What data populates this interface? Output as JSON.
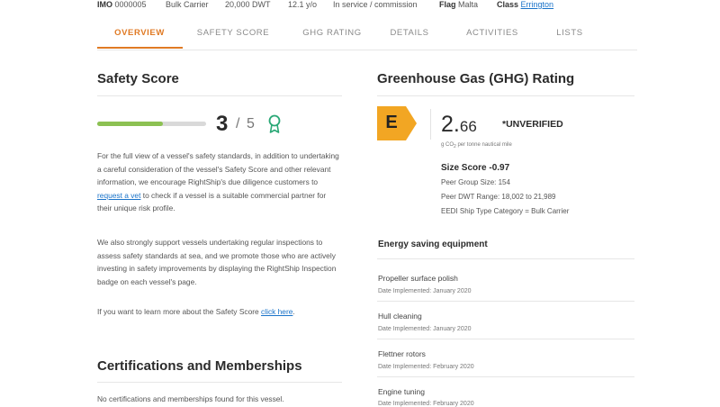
{
  "vessel_info": {
    "imo_label": "IMO",
    "imo_value": "0000005",
    "type": "Bulk Carrier",
    "dwt": "20,000 DWT",
    "age": "12.1 y/o",
    "status": "In service / commission",
    "flag_label": "Flag",
    "flag_value": "Malta",
    "class_label": "Class",
    "class_value": "Errington"
  },
  "tabs": [
    {
      "label": "OVERVIEW",
      "active": true
    },
    {
      "label": "SAFETY SCORE",
      "active": false
    },
    {
      "label": "GHG RATING",
      "active": false
    },
    {
      "label": "DETAILS",
      "active": false
    },
    {
      "label": "ACTIVITIES",
      "active": false
    },
    {
      "label": "LISTS",
      "active": false
    }
  ],
  "safety": {
    "title": "Safety Score",
    "score": "3",
    "separator": "/",
    "out_of": "5",
    "bar_fraction": 0.6,
    "bar_color": "#8cc152",
    "award_icon": "award-ribbon-icon",
    "para1_before": "For the full view of a vessel's safety standards, in addition to undertaking a careful consideration of the vessel's Safety Score and other relevant information, we encourage RightShip's due diligence customers to ",
    "para1_link": "request a vet",
    "para1_after": " to check if a vessel is a suitable commercial partner for their unique risk profile.",
    "para2": "We also strongly support vessels undertaking regular inspections to assess safety standards at sea, and we promote those who are actively investing in safety improvements by displaying the RightShip Inspection badge on each vessel's page.",
    "para3_before": "If you want to learn more about the Safety Score ",
    "para3_link": "click here",
    "para3_after": "."
  },
  "certifications": {
    "title": "Certifications and Memberships",
    "empty_text": "No certifications and memberships found for this vessel."
  },
  "ghg": {
    "title": "Greenhouse Gas (GHG) Rating",
    "rating": "E",
    "rating_color": "#f2a623",
    "value_int": "2.",
    "value_dec": "66",
    "unverified": "*UNVERIFIED",
    "unit_pre": "g CO",
    "unit_sub": "2",
    "unit_post": " per tonne nautical mile",
    "size_score": "Size Score -0.97",
    "peer_group": "Peer Group Size: 154",
    "peer_dwt": "Peer DWT Range: 18,002 to 21,989",
    "eedi": "EEDI Ship Type Category = Bulk Carrier"
  },
  "energy": {
    "title": "Energy saving equipment",
    "items": [
      {
        "name": "Propeller surface polish",
        "date": "Date Implemented: January 2020"
      },
      {
        "name": "Hull cleaning",
        "date": "Date Implemented: January 2020"
      },
      {
        "name": "Flettner rotors",
        "date": "Date Implemented: February 2020"
      },
      {
        "name": "Engine tuning",
        "date": "Date Implemented: February 2020"
      }
    ]
  },
  "colors": {
    "accent": "#e07a24",
    "link": "#1a73c9"
  }
}
